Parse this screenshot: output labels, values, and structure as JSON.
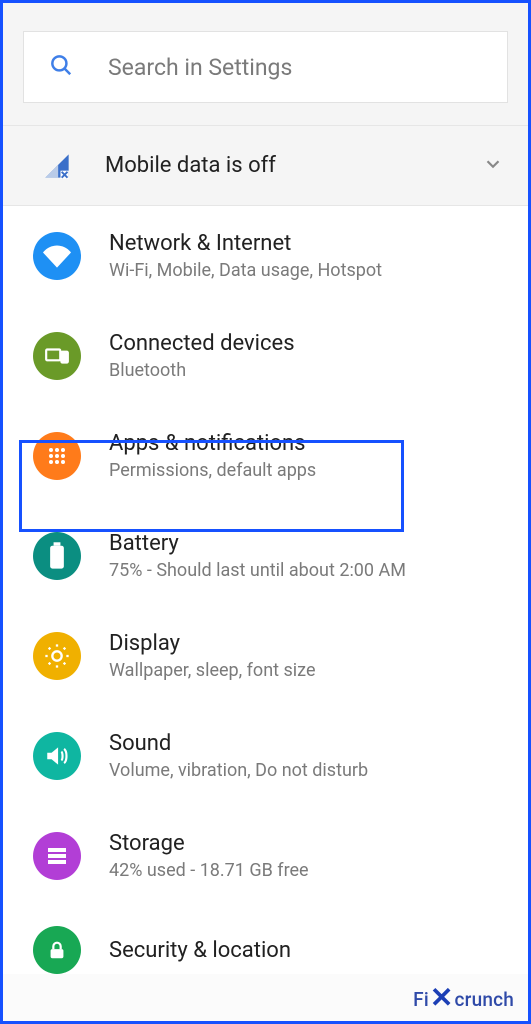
{
  "search": {
    "placeholder": "Search in Settings"
  },
  "banner": {
    "text": "Mobile data is off"
  },
  "items": [
    {
      "title": "Network & Internet",
      "sub": "Wi-Fi, Mobile, Data usage, Hotspot"
    },
    {
      "title": "Connected devices",
      "sub": "Bluetooth"
    },
    {
      "title": "Apps & notifications",
      "sub": "Permissions, default apps"
    },
    {
      "title": "Battery",
      "sub": "75% - Should last until about 2:00 AM"
    },
    {
      "title": "Display",
      "sub": "Wallpaper, sleep, font size"
    },
    {
      "title": "Sound",
      "sub": "Volume, vibration, Do not disturb"
    },
    {
      "title": "Storage",
      "sub": "42% used - 18.71 GB free"
    },
    {
      "title": "Security & location",
      "sub": ""
    }
  ],
  "watermark": {
    "pre": "Fi",
    "post": "crunch"
  }
}
